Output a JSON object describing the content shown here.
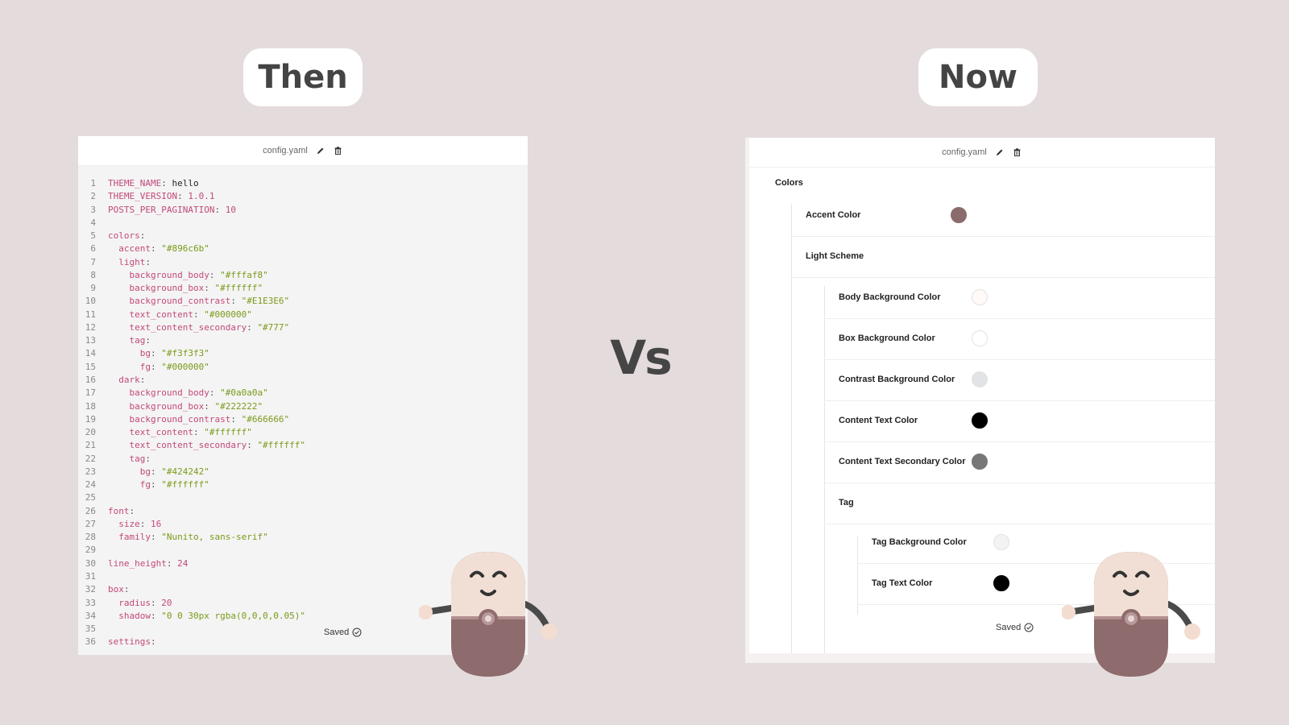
{
  "labels": {
    "then": "Then",
    "now": "Now",
    "vs": "Vs"
  },
  "left_panel": {
    "filename": "config.yaml",
    "status": "Saved",
    "code_lines": [
      [
        {
          "t": "THEME_NAME",
          "c": "k"
        },
        {
          "t": ": ",
          "c": "p"
        },
        {
          "t": "hello",
          "c": "v"
        }
      ],
      [
        {
          "t": "THEME_VERSION",
          "c": "k"
        },
        {
          "t": ": ",
          "c": "p"
        },
        {
          "t": "1.0.1",
          "c": "k"
        }
      ],
      [
        {
          "t": "POSTS_PER_PAGINATION",
          "c": "k"
        },
        {
          "t": ": ",
          "c": "p"
        },
        {
          "t": "10",
          "c": "k"
        }
      ],
      [],
      [
        {
          "t": "colors",
          "c": "k"
        },
        {
          "t": ":",
          "c": "p"
        }
      ],
      [
        {
          "t": "  accent",
          "c": "k"
        },
        {
          "t": ": ",
          "c": "p"
        },
        {
          "t": "\"#896c6b\"",
          "c": "s"
        }
      ],
      [
        {
          "t": "  light",
          "c": "k"
        },
        {
          "t": ":",
          "c": "p"
        }
      ],
      [
        {
          "t": "    background_body",
          "c": "k"
        },
        {
          "t": ": ",
          "c": "p"
        },
        {
          "t": "\"#fffaf8\"",
          "c": "s"
        }
      ],
      [
        {
          "t": "    background_box",
          "c": "k"
        },
        {
          "t": ": ",
          "c": "p"
        },
        {
          "t": "\"#ffffff\"",
          "c": "s"
        }
      ],
      [
        {
          "t": "    background_contrast",
          "c": "k"
        },
        {
          "t": ": ",
          "c": "p"
        },
        {
          "t": "\"#E1E3E6\"",
          "c": "s"
        }
      ],
      [
        {
          "t": "    text_content",
          "c": "k"
        },
        {
          "t": ": ",
          "c": "p"
        },
        {
          "t": "\"#000000\"",
          "c": "s"
        }
      ],
      [
        {
          "t": "    text_content_secondary",
          "c": "k"
        },
        {
          "t": ": ",
          "c": "p"
        },
        {
          "t": "\"#777\"",
          "c": "s"
        }
      ],
      [
        {
          "t": "    tag",
          "c": "k"
        },
        {
          "t": ":",
          "c": "p"
        }
      ],
      [
        {
          "t": "      bg",
          "c": "k"
        },
        {
          "t": ": ",
          "c": "p"
        },
        {
          "t": "\"#f3f3f3\"",
          "c": "s"
        }
      ],
      [
        {
          "t": "      fg",
          "c": "k"
        },
        {
          "t": ": ",
          "c": "p"
        },
        {
          "t": "\"#000000\"",
          "c": "s"
        }
      ],
      [
        {
          "t": "  dark",
          "c": "k"
        },
        {
          "t": ":",
          "c": "p"
        }
      ],
      [
        {
          "t": "    background_body",
          "c": "k"
        },
        {
          "t": ": ",
          "c": "p"
        },
        {
          "t": "\"#0a0a0a\"",
          "c": "s"
        }
      ],
      [
        {
          "t": "    background_box",
          "c": "k"
        },
        {
          "t": ": ",
          "c": "p"
        },
        {
          "t": "\"#222222\"",
          "c": "s"
        }
      ],
      [
        {
          "t": "    background_contrast",
          "c": "k"
        },
        {
          "t": ": ",
          "c": "p"
        },
        {
          "t": "\"#666666\"",
          "c": "s"
        }
      ],
      [
        {
          "t": "    text_content",
          "c": "k"
        },
        {
          "t": ": ",
          "c": "p"
        },
        {
          "t": "\"#ffffff\"",
          "c": "s"
        }
      ],
      [
        {
          "t": "    text_content_secondary",
          "c": "k"
        },
        {
          "t": ": ",
          "c": "p"
        },
        {
          "t": "\"#ffffff\"",
          "c": "s"
        }
      ],
      [
        {
          "t": "    tag",
          "c": "k"
        },
        {
          "t": ":",
          "c": "p"
        }
      ],
      [
        {
          "t": "      bg",
          "c": "k"
        },
        {
          "t": ": ",
          "c": "p"
        },
        {
          "t": "\"#424242\"",
          "c": "s"
        }
      ],
      [
        {
          "t": "      fg",
          "c": "k"
        },
        {
          "t": ": ",
          "c": "p"
        },
        {
          "t": "\"#ffffff\"",
          "c": "s"
        }
      ],
      [],
      [
        {
          "t": "font",
          "c": "k"
        },
        {
          "t": ":",
          "c": "p"
        }
      ],
      [
        {
          "t": "  size",
          "c": "k"
        },
        {
          "t": ": ",
          "c": "p"
        },
        {
          "t": "16",
          "c": "k"
        }
      ],
      [
        {
          "t": "  family",
          "c": "k"
        },
        {
          "t": ": ",
          "c": "p"
        },
        {
          "t": "\"Nunito, sans-serif\"",
          "c": "s"
        }
      ],
      [],
      [
        {
          "t": "line_height",
          "c": "k"
        },
        {
          "t": ": ",
          "c": "p"
        },
        {
          "t": "24",
          "c": "k"
        }
      ],
      [],
      [
        {
          "t": "box",
          "c": "k"
        },
        {
          "t": ":",
          "c": "p"
        }
      ],
      [
        {
          "t": "  radius",
          "c": "k"
        },
        {
          "t": ": ",
          "c": "p"
        },
        {
          "t": "20",
          "c": "k"
        }
      ],
      [
        {
          "t": "  shadow",
          "c": "k"
        },
        {
          "t": ": ",
          "c": "p"
        },
        {
          "t": "\"0 0 30px rgba(0,0,0,0.05)\"",
          "c": "s"
        }
      ],
      [],
      [
        {
          "t": "settings",
          "c": "k"
        },
        {
          "t": ":",
          "c": "p"
        }
      ]
    ]
  },
  "right_panel": {
    "filename": "config.yaml",
    "status": "Saved",
    "section_title": "Colors",
    "rows": [
      {
        "label": "Accent Color",
        "color": "#896c6b"
      },
      {
        "label": "Light Scheme"
      },
      {
        "label": "Body Background Color",
        "color": "#fffaf8"
      },
      {
        "label": "Box Background Color",
        "color": "#ffffff"
      },
      {
        "label": "Contrast Background Color",
        "color": "#E1E3E6"
      },
      {
        "label": "Content Text Color",
        "color": "#000000"
      },
      {
        "label": "Content Text Secondary Color",
        "color": "#777777"
      },
      {
        "label": "Tag"
      },
      {
        "label": "Tag Background Color",
        "color": "#f3f3f3"
      },
      {
        "label": "Tag Text Color",
        "color": "#000000"
      }
    ]
  }
}
